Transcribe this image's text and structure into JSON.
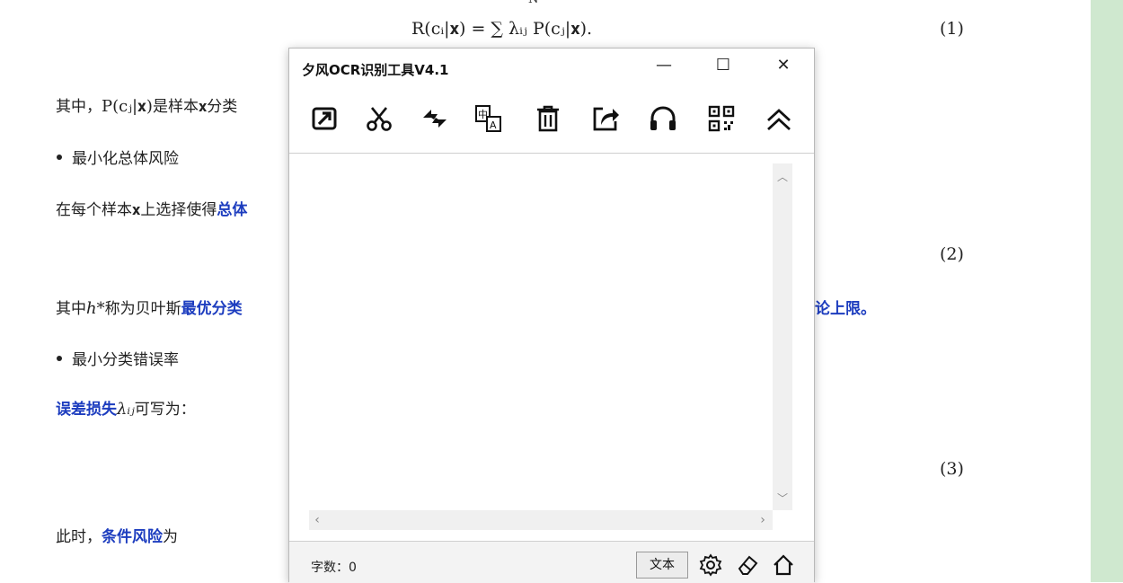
{
  "doc": {
    "eq1": "R(cᵢ|𝐱) = ∑ λᵢⱼ P(cⱼ|𝐱).",
    "eq1_sum_limit": "N",
    "eq1_num": "(1)",
    "line1_prefix": "其中，",
    "line1_math": "P(cⱼ|𝐱)",
    "line1_suffix": "是样本𝐱分类",
    "bullet1": "最小化总体风险",
    "line2_prefix": "在每个样本𝐱上选择使得",
    "line2_hl": "总体",
    "eq2_num": "(2)",
    "line3_prefix": "其中",
    "line3_math": "h*",
    "line3_mid": "称为贝叶斯",
    "line3_hl": "最优分类",
    "line3_right_hl": "论上限",
    "line3_right_end": "。",
    "bullet2": "最小分类错误率",
    "line4_hl": "误差损失",
    "line4_math": "λᵢⱼ",
    "line4_suffix": "可写为：",
    "eq3_num": "(3)",
    "line5_prefix": "此时，",
    "line5_hl": "条件风险",
    "line5_suffix": "为"
  },
  "ocr_window": {
    "title": "夕风OCR识别工具V4.1",
    "controls": {
      "minimize": "—",
      "maximize": "☐",
      "close": "✕"
    },
    "toolbar": [
      "screenshot-icon",
      "scissors-icon",
      "swap-icon",
      "translate-icon",
      "trash-icon",
      "share-icon",
      "headphones-icon",
      "qrcode-icon",
      "collapse-icon"
    ],
    "text_content": "",
    "status": {
      "char_count_label": "字数：0",
      "mode_button": "文本"
    }
  },
  "colors": {
    "highlight": "#1d3dbf",
    "side_panel": "#cfe8cf"
  }
}
